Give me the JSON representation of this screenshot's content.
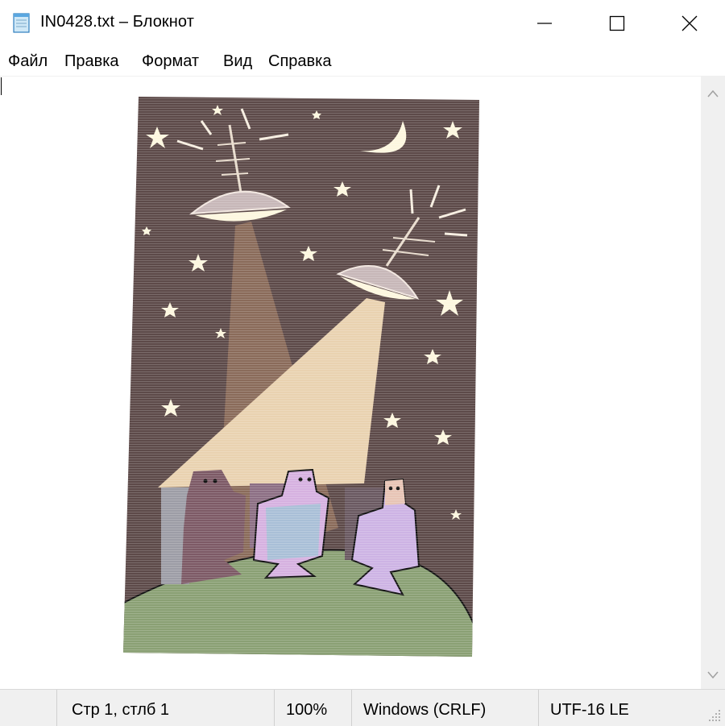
{
  "window": {
    "title": "IN0428.txt – Блокнот",
    "minimize_icon": "minimize-icon",
    "maximize_icon": "maximize-icon",
    "close_icon": "close-icon"
  },
  "menu": [
    {
      "label": "Файл"
    },
    {
      "label": "Правка"
    },
    {
      "label": "Формат"
    },
    {
      "label": "Вид"
    },
    {
      "label": "Справка"
    }
  ],
  "colors": {
    "sky": "#5d4a49",
    "ground": "#8aa074",
    "beam": "#e9d2b0",
    "lamp": "#fdf7df",
    "figure_left": "#7d5a66",
    "figure_center_head": "#d6b1e0",
    "figure_center_body": "#a9bfd7",
    "figure_right": "#cdb3e4",
    "figure_right_head": "#e7c4b5"
  },
  "status": {
    "position": "Стр 1, стлб 1",
    "zoom": "100%",
    "line_ending": "Windows (CRLF)",
    "encoding": "UTF-16 LE"
  }
}
